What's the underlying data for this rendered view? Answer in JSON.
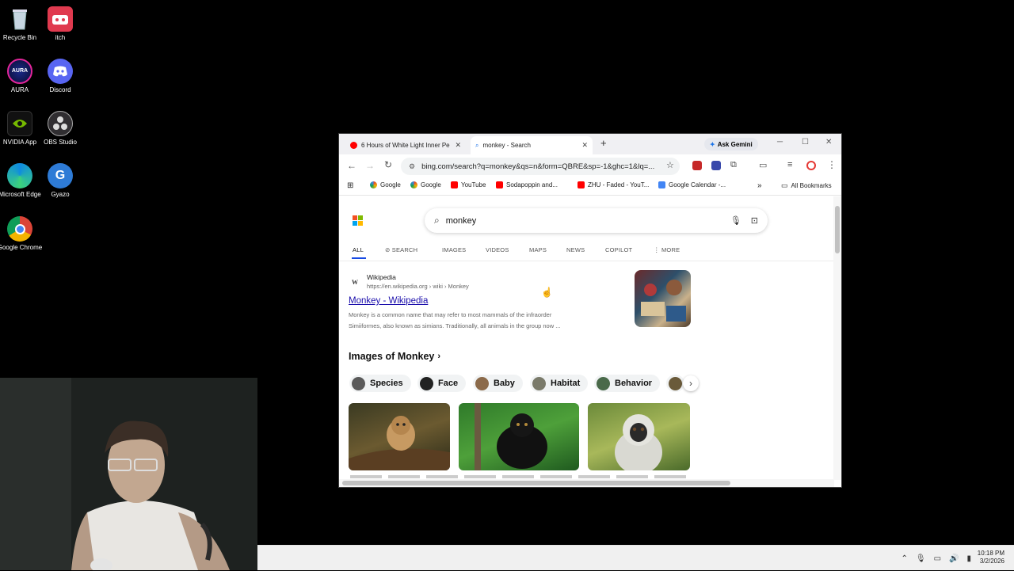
{
  "desktop": {
    "icons": [
      {
        "label": "Recycle Bin",
        "icon": "recycle-bin-icon"
      },
      {
        "label": "itch",
        "icon": "itch-icon"
      },
      {
        "label": "AURA",
        "icon": "aura-icon"
      },
      {
        "label": "Discord",
        "icon": "discord-icon"
      },
      {
        "label": "NVIDIA App",
        "icon": "nvidia-icon"
      },
      {
        "label": "OBS Studio",
        "icon": "obs-icon"
      },
      {
        "label": "Microsoft Edge",
        "icon": "edge-icon"
      },
      {
        "label": "Gyazo",
        "icon": "gyazo-icon"
      },
      {
        "label": "Google Chrome",
        "icon": "chrome-icon"
      }
    ]
  },
  "browser": {
    "tabs": [
      {
        "title": "6 Hours of White Light Inner Pe"
      },
      {
        "title": "monkey - Search"
      }
    ],
    "ask_gemini": "Ask Gemini",
    "url": "bing.com/search?q=monkey&qs=n&form=QBRE&sp=-1&ghc=1&lq=...",
    "bookmarks": [
      "Google",
      "Google",
      "YouTube",
      "Sodapoppin and...",
      "ZHU - Faded - YouT...",
      "Google Calendar -..."
    ],
    "all_bookmarks": "All Bookmarks"
  },
  "search": {
    "query": "monkey",
    "nav": [
      "ALL",
      "SEARCH",
      "IMAGES",
      "VIDEOS",
      "MAPS",
      "NEWS",
      "COPILOT",
      "MORE"
    ],
    "result": {
      "site": "Wikipedia",
      "site_url": "https://en.wikipedia.org › wiki › Monkey",
      "title": "Monkey - Wikipedia",
      "snippet_1": "Monkey is a common name that may refer to most mammals of the infraorder",
      "snippet_2": "Simiiformes, also known as simians. Traditionally, all animals in the group now ..."
    },
    "images_heading": "Images of Monkey",
    "chips": [
      "Species",
      "Face",
      "Baby",
      "Habitat",
      "Behavior"
    ]
  },
  "taskbar": {
    "time": "10:18 PM",
    "date": "3/2/2026"
  },
  "colors": {
    "link": "#1a0dab",
    "accent": "#1a73e8",
    "desktop": "#000000"
  }
}
